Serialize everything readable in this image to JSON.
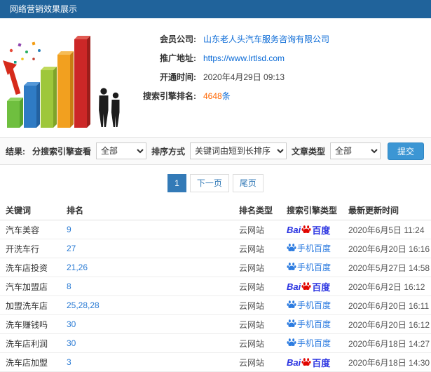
{
  "header": {
    "title": "网络营销效果展示"
  },
  "info": {
    "company_label": "会员公司:",
    "company_value": "山东老人头汽车服务咨询有限公司",
    "url_label": "推广地址:",
    "url_value": "https://www.lrtlsd.com",
    "open_label": "开通时间:",
    "open_value": "2020年4月29日 09:13",
    "rank_label": "搜索引擎排名:",
    "rank_count": "4648",
    "rank_unit": "条"
  },
  "filters": {
    "section_label": "结果:",
    "engine_label": "分搜索引擎查看",
    "engine_value": "全部",
    "sort_label": "排序方式",
    "sort_value": "关键词由短到长排序",
    "type_label": "文章类型",
    "type_value": "全部",
    "submit_label": "提交"
  },
  "pagination": {
    "current": "1",
    "next": "下一页",
    "last": "尾页"
  },
  "engines": {
    "baidu": {
      "prefix": "Bai",
      "suffix": "百度"
    },
    "mobile": {
      "label": "手机百度"
    }
  },
  "table": {
    "headers": [
      "关键词",
      "排名",
      "排名类型",
      "搜索引擎类型",
      "最新更新时间"
    ],
    "rows": [
      {
        "keyword": "汽车美容",
        "rank": "9",
        "rank_type": "云网站",
        "engine": "baidu",
        "time": "2020年6月5日 11:24"
      },
      {
        "keyword": "开洗车行",
        "rank": "27",
        "rank_type": "云网站",
        "engine": "mobile",
        "time": "2020年6月20日 16:16"
      },
      {
        "keyword": "洗车店投资",
        "rank": "21,26",
        "rank_type": "云网站",
        "engine": "mobile",
        "time": "2020年5月27日 14:58"
      },
      {
        "keyword": "汽车加盟店",
        "rank": "8",
        "rank_type": "云网站",
        "engine": "baidu",
        "time": "2020年6月2日 16:12"
      },
      {
        "keyword": "加盟洗车店",
        "rank": "25,28,28",
        "rank_type": "云网站",
        "engine": "mobile",
        "time": "2020年6月20日 16:11"
      },
      {
        "keyword": "洗车赚钱吗",
        "rank": "30",
        "rank_type": "云网站",
        "engine": "mobile",
        "time": "2020年6月20日 16:12"
      },
      {
        "keyword": "洗车店利润",
        "rank": "30",
        "rank_type": "云网站",
        "engine": "mobile",
        "time": "2020年6月18日 14:27"
      },
      {
        "keyword": "洗车店加盟",
        "rank": "3",
        "rank_type": "云网站",
        "engine": "baidu",
        "time": "2020年6月18日 14:30"
      }
    ]
  }
}
